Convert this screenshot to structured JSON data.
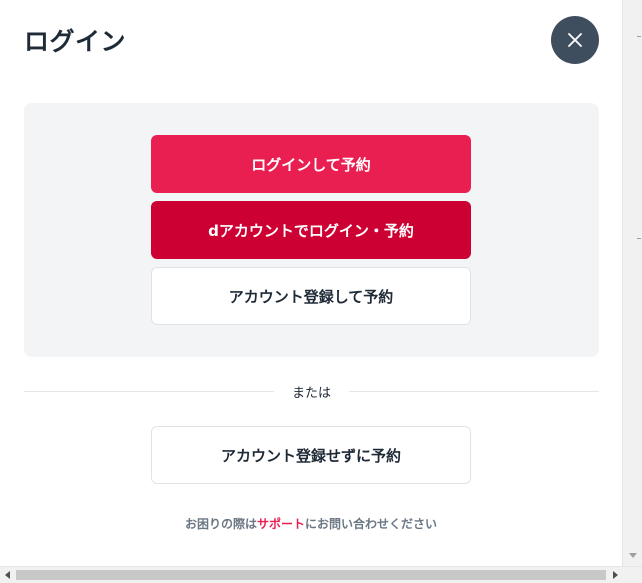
{
  "modal": {
    "title": "ログイン",
    "close_icon": "close-icon"
  },
  "login_panel": {
    "login_button": "ログインして予約",
    "daccount_button": "dアカウントでログイン・予約",
    "register_button": "アカウント登録して予約"
  },
  "divider": {
    "text": "または"
  },
  "guest_button": "アカウント登録せずに予約",
  "help": {
    "prefix": "お困りの際は",
    "link": "サポート",
    "suffix": "にお問い合わせください"
  },
  "colors": {
    "primary": "#e91e51",
    "daccount": "#cc0033",
    "close_bg": "#3f4e5f",
    "title": "#1f2a37",
    "panel_bg": "#f3f4f6"
  }
}
